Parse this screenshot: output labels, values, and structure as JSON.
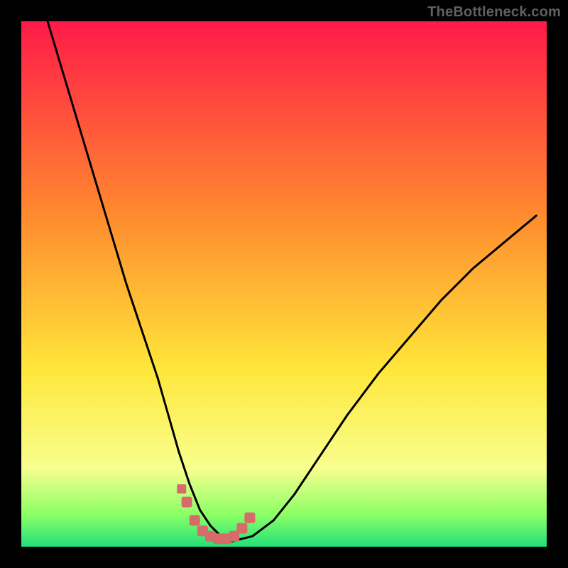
{
  "watermark": "TheBottleneck.com",
  "colors": {
    "gradient_top": "#ff1a49",
    "gradient_mid1": "#ff8e2e",
    "gradient_mid2": "#ffe63a",
    "gradient_low": "#f8ff8e",
    "gradient_green1": "#8aff66",
    "gradient_green2": "#22e07a",
    "curve": "#000000",
    "marker": "#d96a6a"
  },
  "chart_data": {
    "type": "line",
    "title": "",
    "xlabel": "",
    "ylabel": "",
    "xlim": [
      0,
      100
    ],
    "ylim": [
      0,
      100
    ],
    "series": [
      {
        "name": "bottleneck-curve",
        "x": [
          5,
          8,
          11,
          14,
          17,
          20,
          23,
          26,
          28,
          30,
          32,
          34,
          36,
          38,
          40,
          44,
          48,
          52,
          56,
          62,
          68,
          74,
          80,
          86,
          92,
          98
        ],
        "values": [
          100,
          90,
          80,
          70,
          60,
          50,
          41,
          32,
          25,
          18,
          12,
          7,
          4,
          2,
          1,
          2,
          5,
          10,
          16,
          25,
          33,
          40,
          47,
          53,
          58,
          63
        ]
      }
    ],
    "markers": {
      "name": "highlight-band",
      "x": [
        31.5,
        33,
        34.5,
        36,
        37.5,
        39,
        40.5,
        42,
        43.5
      ],
      "values": [
        8.5,
        5,
        3,
        2,
        1.5,
        1.5,
        2,
        3.5,
        5.5
      ]
    },
    "extra_marker": {
      "x": 30.5,
      "value": 11
    }
  }
}
